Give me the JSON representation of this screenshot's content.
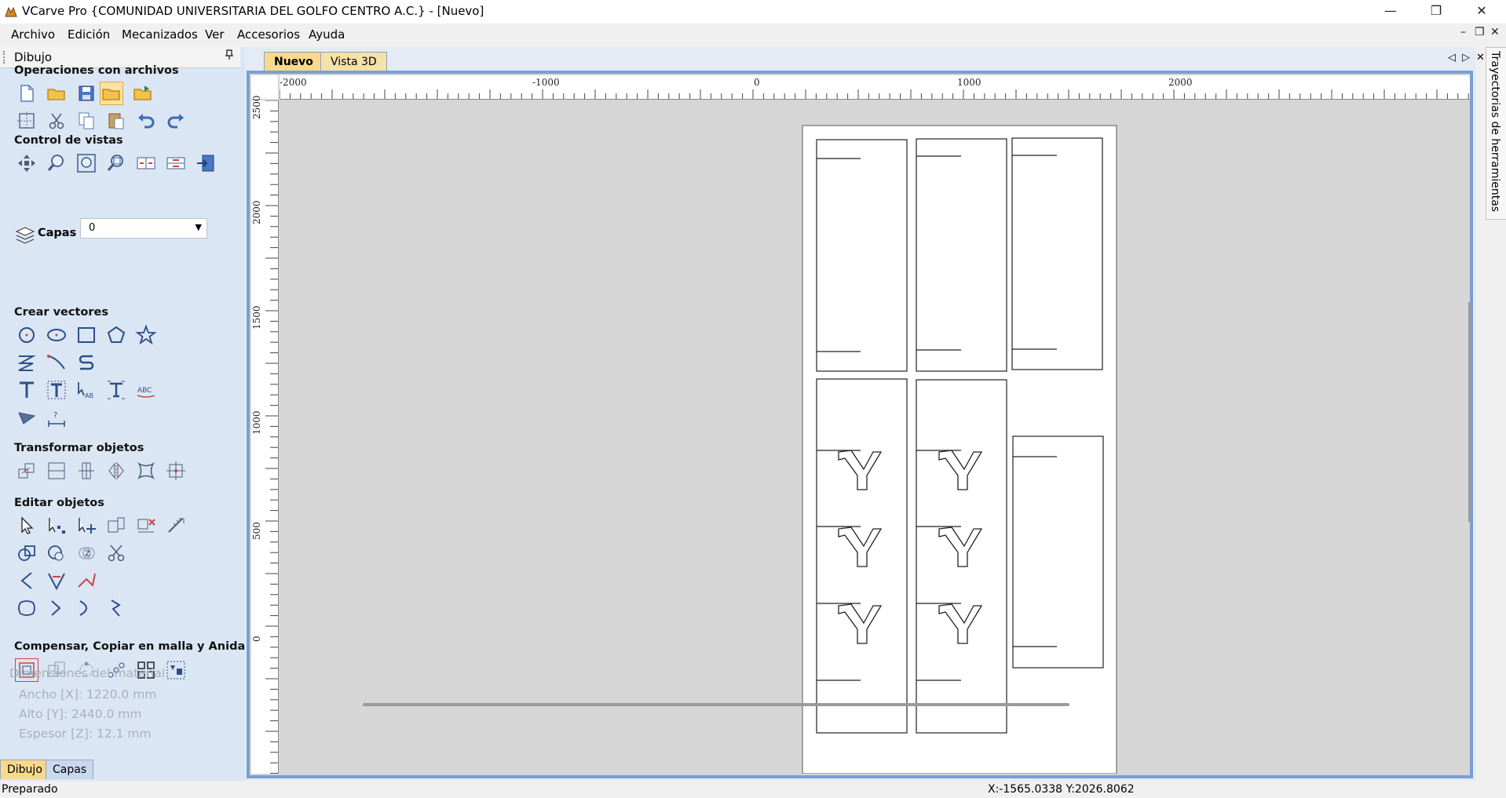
{
  "window": {
    "title": "VCarve Pro {COMUNIDAD UNIVERSITARIA DEL GOLFO CENTRO  A.C.} - [Nuevo]",
    "minimize": "—",
    "restore": "❐",
    "close": "✕"
  },
  "menu": {
    "items": [
      "Archivo",
      "Edición",
      "Mecanizados",
      "Ver",
      "Accesorios",
      "Ayuda"
    ],
    "doc_minimize": "–",
    "doc_restore": "❐",
    "doc_close": "✕"
  },
  "panel": {
    "title": "Dibujo",
    "pin": "📌",
    "sections": {
      "file_ops": "Operaciones con archivos",
      "view_control": "Control de vistas",
      "create_vectors": "Crear vectores",
      "transform": "Transformar objetos",
      "edit": "Editar objetos",
      "offset": "Compensar, Copiar en malla y Anidar"
    },
    "layers_label": "Capas",
    "layers_value": "0",
    "dimensions_label": "Dimensiones del material",
    "width_text": "Ancho    [X]: 1220.0 mm",
    "height_text": "Alto     [Y]: 2440.0 mm",
    "thickness_text": "Espesor [Z]: 12.1 mm",
    "tabs": [
      "Dibujo",
      "Capas"
    ]
  },
  "doc_tabs": [
    "Nuevo",
    "Vista 3D"
  ],
  "doc_nav": {
    "prev": "◁",
    "next": "▷",
    "close": "✕"
  },
  "ruler": {
    "h_labels": [
      "-2000",
      "-1000",
      "0",
      "1000",
      "2000"
    ],
    "v_labels": [
      "2500",
      "2000",
      "1500",
      "1000",
      "500",
      "0"
    ]
  },
  "side_panel_label": "Trayectorias de herramientas",
  "status": {
    "left": "Preparado",
    "coords": "X:-1565.0338 Y:2026.8062"
  },
  "colors": {
    "panel_bg": "#dbe6f4",
    "doc_frame": "#7a9fd2",
    "active_tab": "#f7d98c",
    "canvas_bg": "#d6d6d6"
  }
}
